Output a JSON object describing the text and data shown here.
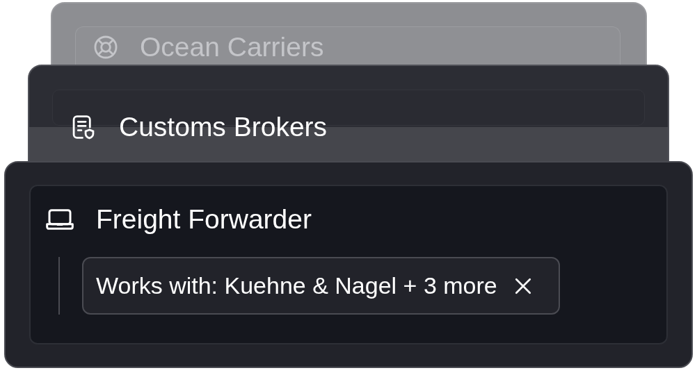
{
  "cards": [
    {
      "title": "Ocean Carriers"
    },
    {
      "title": "Customs Brokers"
    },
    {
      "title": "Freight Forwarder",
      "tag": {
        "text": "Works with: Kuehne & Nagel + 3 more"
      }
    }
  ]
}
